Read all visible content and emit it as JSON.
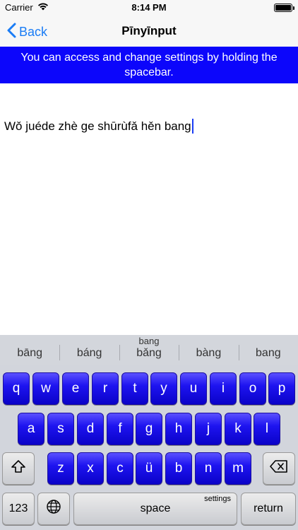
{
  "status_bar": {
    "carrier": "Carrier",
    "time": "8:14 PM"
  },
  "nav": {
    "back_label": "Back",
    "title": "Pīnyīnput"
  },
  "banner": {
    "text": "You can access and change settings by holding the spacebar."
  },
  "editor": {
    "text": "Wǒ juéde zhè ge shūrùfǎ hěn bang"
  },
  "keyboard": {
    "candidate_top": "bang",
    "candidates": [
      "bāng",
      "báng",
      "bǎng",
      "bàng",
      "bang"
    ],
    "row1": [
      "q",
      "w",
      "e",
      "r",
      "t",
      "y",
      "u",
      "i",
      "o",
      "p"
    ],
    "row2": [
      "a",
      "s",
      "d",
      "f",
      "g",
      "h",
      "j",
      "k",
      "l"
    ],
    "row3": [
      "z",
      "x",
      "c",
      "ü",
      "b",
      "n",
      "m"
    ],
    "numbers_label": "123",
    "space_label": "space",
    "settings_label": "settings",
    "return_label": "return"
  },
  "colors": {
    "banner_bg": "#0c06fb",
    "key_blue": "#1e14f0",
    "accent": "#1a7cf5"
  }
}
